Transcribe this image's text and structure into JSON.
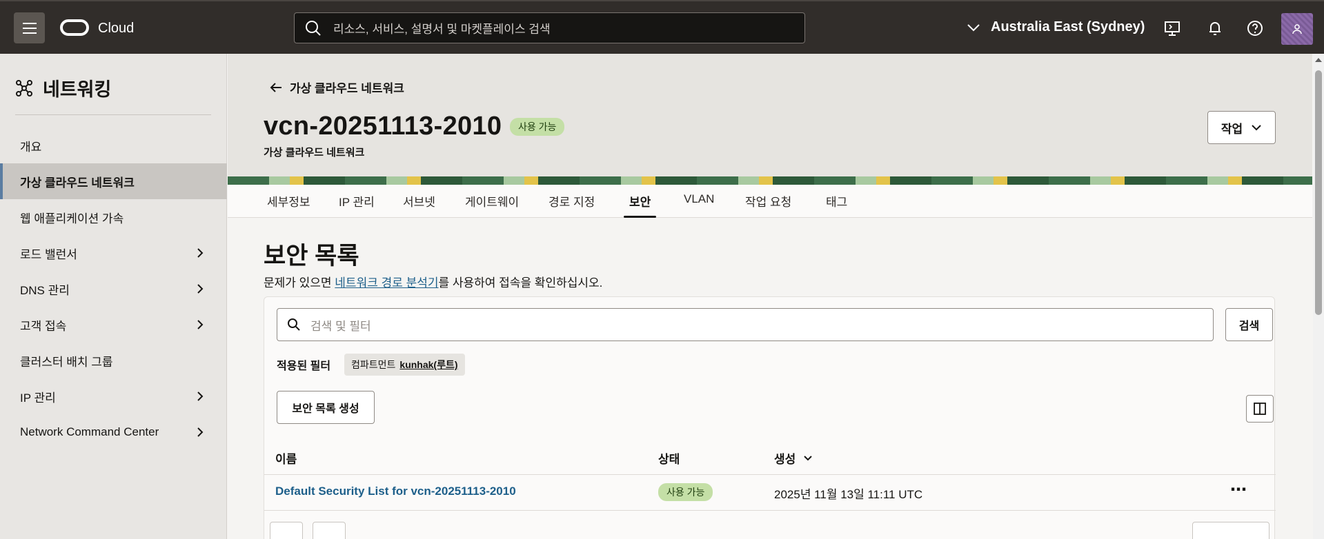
{
  "topbar": {
    "brand": "Cloud",
    "search_placeholder": "리소스, 서비스, 설명서 및 마켓플레이스 검색",
    "region": "Australia East (Sydney)",
    "icons": [
      "hamburger-menu-icon",
      "oracle-logo",
      "search-icon",
      "chevron-down-icon",
      "cloud-shell-icon",
      "bell-icon",
      "help-icon",
      "user-avatar"
    ]
  },
  "sidebar": {
    "title": "네트워킹",
    "items": [
      {
        "label": "개요",
        "has_arrow": false
      },
      {
        "label": "가상 클라우드 네트워크",
        "has_arrow": false,
        "active": true
      },
      {
        "label": "웹 애플리케이션 가속",
        "has_arrow": false
      },
      {
        "label": "로드 밸런서",
        "has_arrow": true
      },
      {
        "label": "DNS 관리",
        "has_arrow": true
      },
      {
        "label": "고객 접속",
        "has_arrow": true
      },
      {
        "label": "클러스터 배치 그룹",
        "has_arrow": false
      },
      {
        "label": "IP 관리",
        "has_arrow": true
      },
      {
        "label": "Network Command Center",
        "has_arrow": true
      }
    ]
  },
  "header": {
    "back_label": "가상 클라우드 네트워크",
    "title": "vcn-20251113-2010",
    "status": "사용 가능",
    "subtitle": "가상 클라우드 네트워크",
    "action_label": "작업"
  },
  "tabs": [
    "세부정보",
    "IP 관리",
    "서브넷",
    "게이트웨이",
    "경로 지정",
    "보안",
    "VLAN",
    "작업 요청",
    "태그"
  ],
  "active_tab": "보안",
  "section": {
    "title": "보안 목록",
    "desc_before": "문제가 있으면 ",
    "desc_link": "네트워크 경로 분석기",
    "desc_after": "를 사용하여 접속을 확인하십시오."
  },
  "filter": {
    "placeholder": "검색 및 필터",
    "search_button": "검색",
    "applied_label": "적용된 필터",
    "chip_key": "컴파트먼트",
    "chip_value": "kunhak(루트)"
  },
  "create_button": "보안 목록 생성",
  "table": {
    "columns": [
      "이름",
      "상태",
      "생성"
    ],
    "rows": [
      {
        "name": "Default Security List for vcn-20251113-2010",
        "status": "사용 가능",
        "created": "2025년 11월 13일 11:11 UTC"
      }
    ]
  },
  "colors": {
    "topbar_bg": "#312d2a",
    "sidebar_bg": "#e8e6e3",
    "link": "#1d5f8a",
    "badge_bg": "#c4dfa6"
  }
}
